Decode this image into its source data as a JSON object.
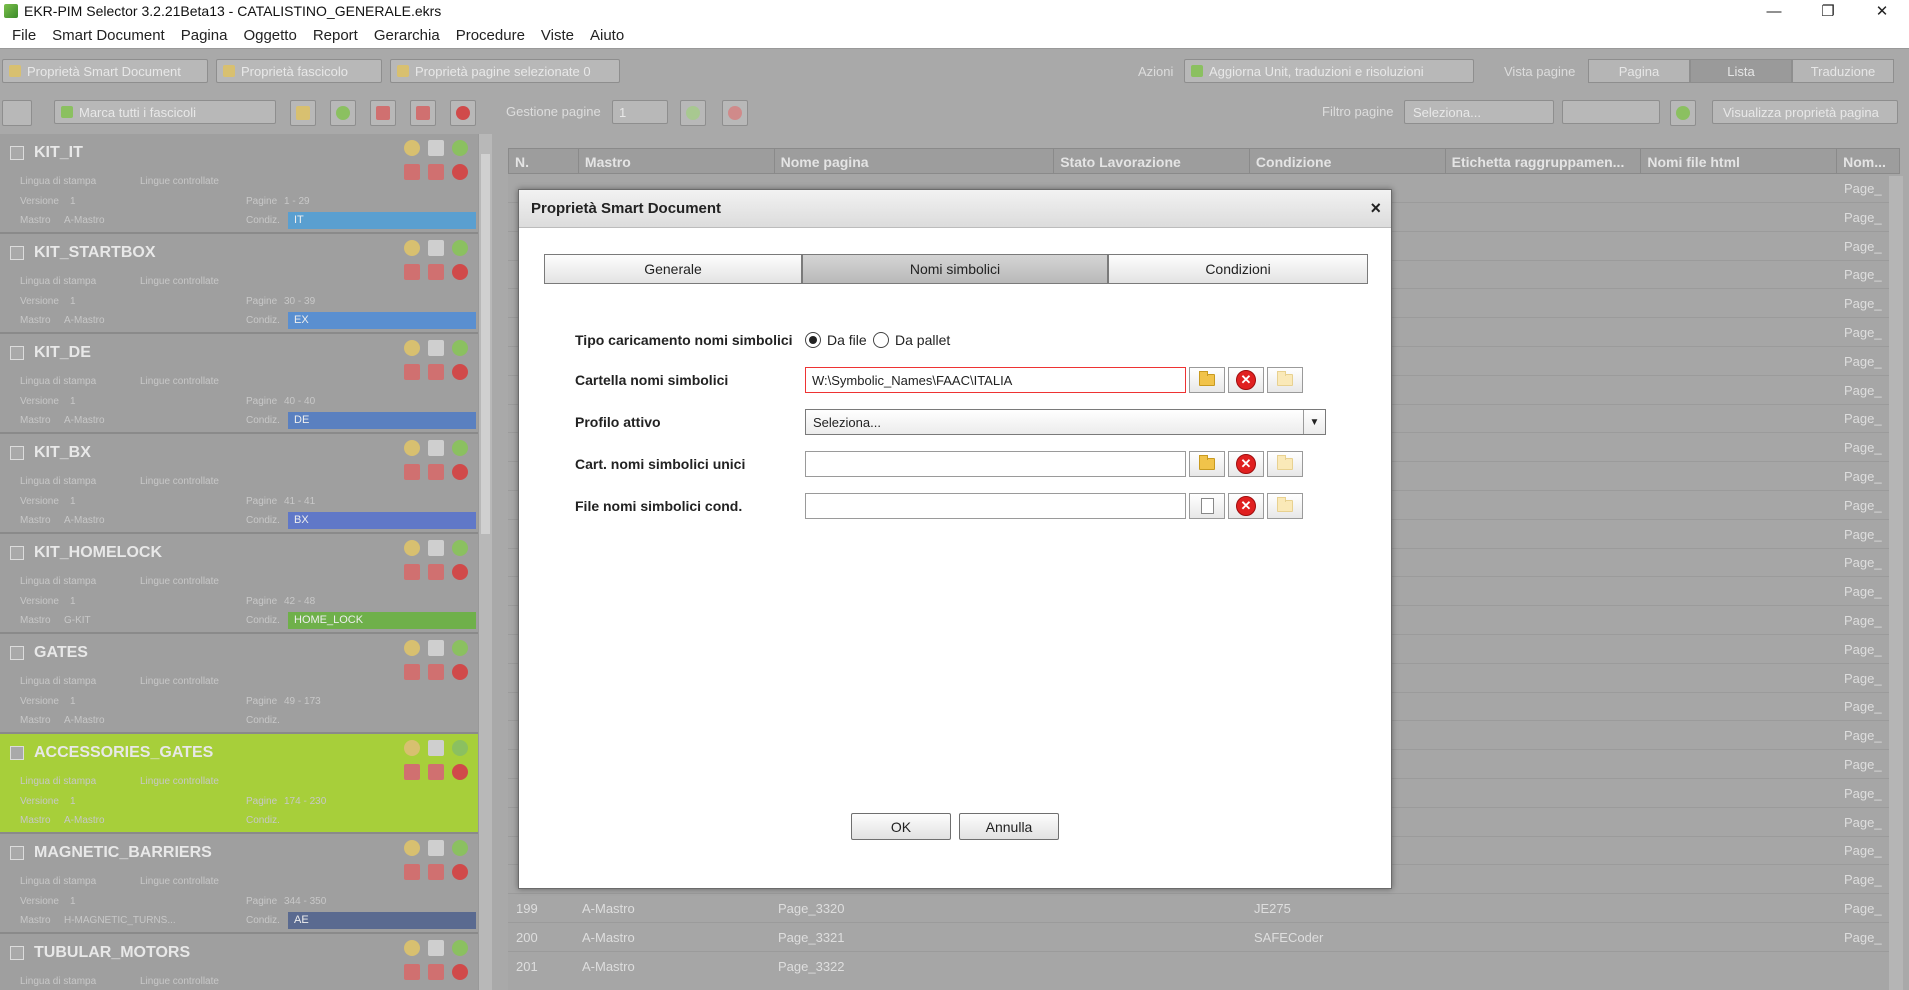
{
  "window": {
    "title": "EKR-PIM Selector 3.2.21Beta13 - CATALISTINO_GENERALE.ekrs",
    "minimize": "—",
    "restore": "❐",
    "close": "✕"
  },
  "menu": [
    "File",
    "Smart Document",
    "Pagina",
    "Oggetto",
    "Report",
    "Gerarchia",
    "Procedure",
    "Viste",
    "Aiuto"
  ],
  "toolbar1": {
    "prop_smart": "Proprietà Smart Document",
    "prop_fasc": "Proprietà fascicolo",
    "prop_pagine": "Proprietà pagine selezionate 0",
    "azioni_label": "Azioni",
    "azioni_value": "Aggiorna Unit, traduzioni e risoluzioni",
    "vista_label": "Vista pagine",
    "views": [
      "Pagina",
      "Lista",
      "Traduzione"
    ]
  },
  "toolbar2": {
    "marca": "Marca tutti i fascicoli",
    "gestione_label": "Gestione pagine",
    "gestione_value": "1",
    "filtro_label": "Filtro pagine",
    "filtro_value": "Seleziona...",
    "visualizza": "Visualizza proprietà pagina"
  },
  "fascicoli": [
    {
      "name": "KIT_IT",
      "pages": "1 - 29",
      "mastro": "A-Mastro",
      "cond": "IT",
      "cond_color": "#5a9fd0"
    },
    {
      "name": "KIT_STARTBOX",
      "pages": "30 - 39",
      "mastro": "A-Mastro",
      "cond": "EX",
      "cond_color": "#5a8fd0"
    },
    {
      "name": "KIT_DE",
      "pages": "40 - 40",
      "mastro": "A-Mastro",
      "cond": "DE",
      "cond_color": "#5a80c0"
    },
    {
      "name": "KIT_BX",
      "pages": "41 - 41",
      "mastro": "A-Mastro",
      "cond": "BX",
      "cond_color": "#6078c8"
    },
    {
      "name": "KIT_HOMELOCK",
      "pages": "42 - 48",
      "mastro": "G-KIT",
      "cond": "HOME_LOCK",
      "cond_color": "#6fb04a"
    },
    {
      "name": "GATES",
      "pages": "49 - 173",
      "mastro": "A-Mastro",
      "cond": "",
      "cond_color": ""
    },
    {
      "name": "ACCESSORIES_GATES",
      "pages": "174 - 230",
      "mastro": "A-Mastro",
      "cond": "",
      "cond_color": ""
    },
    {
      "name": "MAGNETIC_BARRIERS",
      "pages": "344 - 350",
      "mastro": "H-MAGNETIC_TURNS...",
      "cond": "AE",
      "cond_color": "#5a6a90"
    },
    {
      "name": "TUBULAR_MOTORS",
      "pages": "",
      "mastro": "",
      "cond": "",
      "cond_color": ""
    }
  ],
  "fasc_labels": {
    "lingua": "Lingua di stampa",
    "lingue": "Lingue controllate",
    "versione": "Versione",
    "versione_val": "1",
    "pagine": "Pagine",
    "mastro": "Mastro",
    "condiz": "Condiz."
  },
  "table": {
    "headers": [
      "N.",
      "Mastro",
      "Nome pagina",
      "Stato Lavorazione",
      "Condizione",
      "Etichetta raggruppamen...",
      "Nomi file html",
      "Nom..."
    ],
    "rows": [
      {
        "n": "199",
        "mastro": "A-Mastro",
        "page": "Page_3320",
        "cond": "JE275",
        "nom": "Page_"
      },
      {
        "n": "200",
        "mastro": "A-Mastro",
        "page": "Page_3321",
        "cond": "SAFECoder",
        "nom": "Page_"
      },
      {
        "n": "201",
        "mastro": "A-Mastro",
        "page": "Page_3322",
        "cond": "",
        "nom": "Page_"
      }
    ],
    "side_col": "Page_"
  },
  "modal": {
    "title": "Proprietà Smart Document",
    "close": "×",
    "tabs": [
      "Generale",
      "Nomi simbolici",
      "Condizioni"
    ],
    "tipo_label": "Tipo caricamento nomi simbolici",
    "radio_file": "Da file",
    "radio_pallet": "Da pallet",
    "cartella_label": "Cartella nomi simbolici",
    "cartella_value": "W:\\Symbolic_Names\\FAAC\\ITALIA",
    "profilo_label": "Profilo attivo",
    "profilo_value": "Seleziona...",
    "cart_unici_label": "Cart. nomi simbolici unici",
    "cart_unici_value": "",
    "file_cond_label": "File nomi simbolici cond.",
    "file_cond_value": "",
    "ok": "OK",
    "annulla": "Annulla"
  }
}
